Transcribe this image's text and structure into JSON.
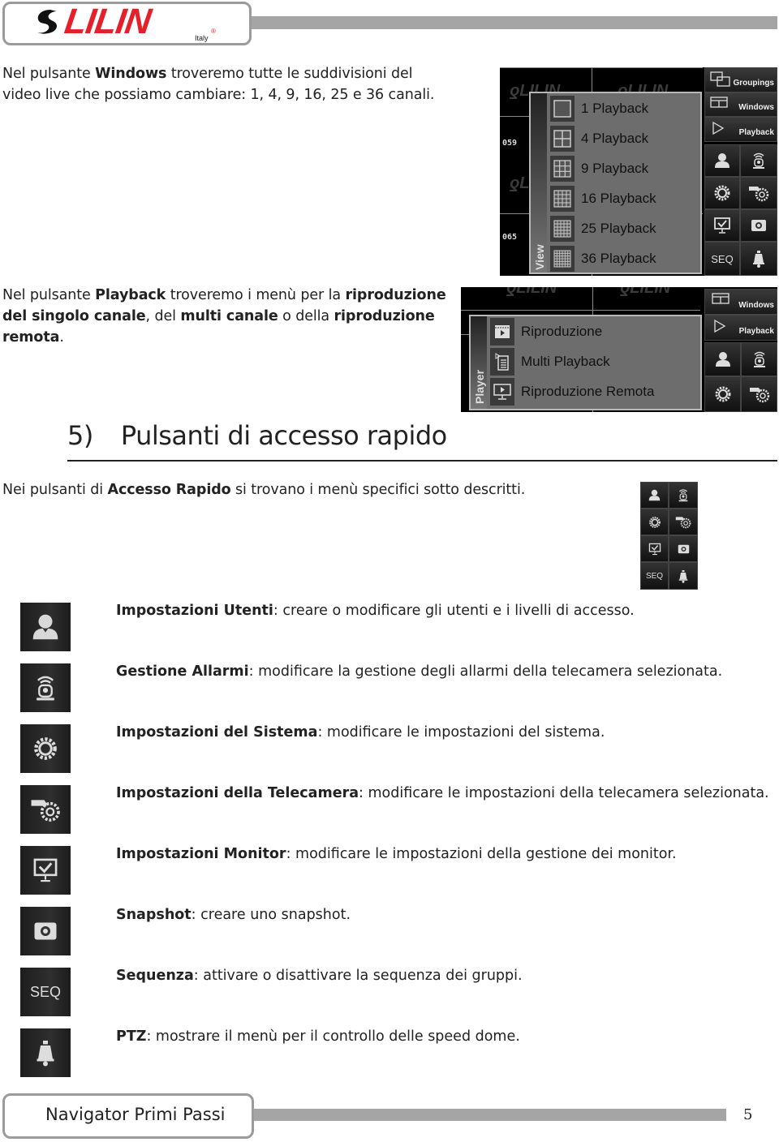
{
  "header": {
    "brand": "LILIN",
    "brand_sub": "Italy",
    "brand_color": "#e4202b"
  },
  "intro_windows": {
    "pre": "Nel pulsante ",
    "bold": "Windows",
    "post": " troveremo tutte le suddivisioni del video live che possiamo cambiare: 1, 4, 9, 16, 25 e 36 canali."
  },
  "intro_playback": {
    "pre": "Nel pulsante ",
    "b1": "Playback",
    "mid1": " troveremo i menù per la ",
    "b2": "riproduzione del singolo canale",
    "mid2": ", del ",
    "b3": "multi canale",
    "mid3": " o della ",
    "b4": "riproduzione remota",
    "end": "."
  },
  "view_menu": {
    "title": "View",
    "items": [
      "1 Playback",
      "4 Playback",
      "9 Playback",
      "16 Playback",
      "25 Playback",
      "36 Playback"
    ],
    "camera_ids": [
      "059",
      "065"
    ]
  },
  "player_menu": {
    "title": "Player",
    "items": [
      "Riproduzione",
      "Multi Playback",
      "Riproduzione Remota"
    ]
  },
  "side_buttons": {
    "groupings": "Groupings",
    "windows": "Windows",
    "playback": "Playback",
    "seq": "SEQ"
  },
  "section": {
    "number": "5)",
    "title": "Pulsanti di accesso rapido"
  },
  "section_intro": {
    "pre": "Nei pulsanti di ",
    "bold": "Accesso Rapido",
    "post": " si trovano i menù specifici sotto descritti."
  },
  "quick_items": [
    {
      "icon": "user-icon",
      "title": "Impostazioni Utenti",
      "desc": ": creare o modificare gli utenti e i livelli di accesso."
    },
    {
      "icon": "alarm-icon",
      "title": "Gestione Allarmi",
      "desc": ": modificare la gestione degli allarmi della telecamera selezionata."
    },
    {
      "icon": "gear-icon",
      "title": "Impostazioni del Sistema",
      "desc": ": modificare le impostazioni del sistema."
    },
    {
      "icon": "camera-settings-icon",
      "title": "Impostazioni della Telecamera",
      "desc": ": modificare le impostazioni della telecamera selezionata."
    },
    {
      "icon": "monitor-icon",
      "title": "Impostazioni Monitor",
      "desc": ": modificare le impostazioni della gestione dei monitor."
    },
    {
      "icon": "snapshot-icon",
      "title": "Snapshot",
      "desc": ": creare uno snapshot."
    },
    {
      "icon": "seq-icon",
      "title": "Sequenza",
      "desc": ": attivare o disattivare la sequenza dei gruppi.",
      "label": "SEQ"
    },
    {
      "icon": "ptz-icon",
      "title": "PTZ",
      "desc": ": mostrare il menù per il controllo delle speed dome."
    }
  ],
  "footer": {
    "title": "Navigator Primi Passi",
    "page": "5"
  }
}
